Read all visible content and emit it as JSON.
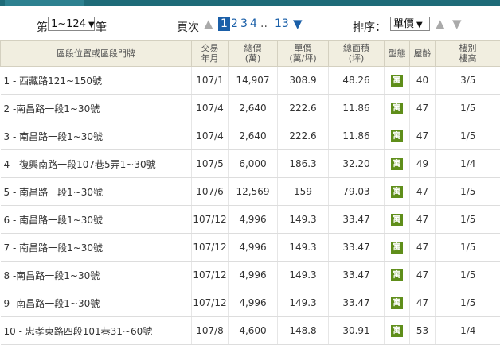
{
  "controls": {
    "range_prefix": "第",
    "range_value": "1~124",
    "range_suffix": "筆",
    "page_label": "頁次",
    "pages": [
      "1",
      "2",
      "3",
      "4"
    ],
    "ellipsis": "..",
    "last_page": "13",
    "sort_label": "排序：",
    "sort_value": "單價"
  },
  "table": {
    "headers": {
      "location": "區段位置或區段門牌",
      "date": [
        "交易",
        "年月"
      ],
      "total": [
        "總價",
        "(萬)"
      ],
      "unit": [
        "單價",
        "(萬/坪)"
      ],
      "area": [
        "總面積",
        "(坪)"
      ],
      "type": "型態",
      "age": "屋齡",
      "floor": [
        "樓別",
        "樓高"
      ]
    },
    "rows": [
      {
        "loc": "1 - 西藏路121~150號",
        "date": "107/1",
        "total": "14,907",
        "unit": "308.9",
        "area": "48.26",
        "type": "寓",
        "age": "40",
        "floor": "3/5"
      },
      {
        "loc": "2 -南昌路一段1~30號",
        "date": "107/4",
        "total": "2,640",
        "unit": "222.6",
        "area": "11.86",
        "type": "寓",
        "age": "47",
        "floor": "1/5"
      },
      {
        "loc": "3 - 南昌路一段1~30號",
        "date": "107/4",
        "total": "2,640",
        "unit": "222.6",
        "area": "11.86",
        "type": "寓",
        "age": "47",
        "floor": "1/5"
      },
      {
        "loc": "4 - 復興南路一段107巷5弄1~30號",
        "date": "107/5",
        "total": "6,000",
        "unit": "186.3",
        "area": "32.20",
        "type": "寓",
        "age": "49",
        "floor": "1/4"
      },
      {
        "loc": "5 - 南昌路一段1~30號",
        "date": "107/6",
        "total": "12,569",
        "unit": "159",
        "area": "79.03",
        "type": "寓",
        "age": "47",
        "floor": "1/5"
      },
      {
        "loc": "6 - 南昌路一段1~30號",
        "date": "107/12",
        "total": "4,996",
        "unit": "149.3",
        "area": "33.47",
        "type": "寓",
        "age": "47",
        "floor": "1/5"
      },
      {
        "loc": "7 - 南昌路一段1~30號",
        "date": "107/12",
        "total": "4,996",
        "unit": "149.3",
        "area": "33.47",
        "type": "寓",
        "age": "47",
        "floor": "1/5"
      },
      {
        "loc": "8 -南昌路一段1~30號",
        "date": "107/12",
        "total": "4,996",
        "unit": "149.3",
        "area": "33.47",
        "type": "寓",
        "age": "47",
        "floor": "1/5"
      },
      {
        "loc": "9 -南昌路一段1~30號",
        "date": "107/12",
        "total": "4,996",
        "unit": "149.3",
        "area": "33.47",
        "type": "寓",
        "age": "47",
        "floor": "1/5"
      },
      {
        "loc": "10 - 忠孝東路四段101巷31~60號",
        "date": "107/8",
        "total": "4,600",
        "unit": "148.8",
        "area": "30.91",
        "type": "寓",
        "age": "53",
        "floor": "1/4"
      }
    ]
  },
  "colors": {
    "header_bar": "#1e6b78",
    "link": "#1a5fa8",
    "badge": "#5f8e1a",
    "table_header_bg": "#f1eee0"
  }
}
